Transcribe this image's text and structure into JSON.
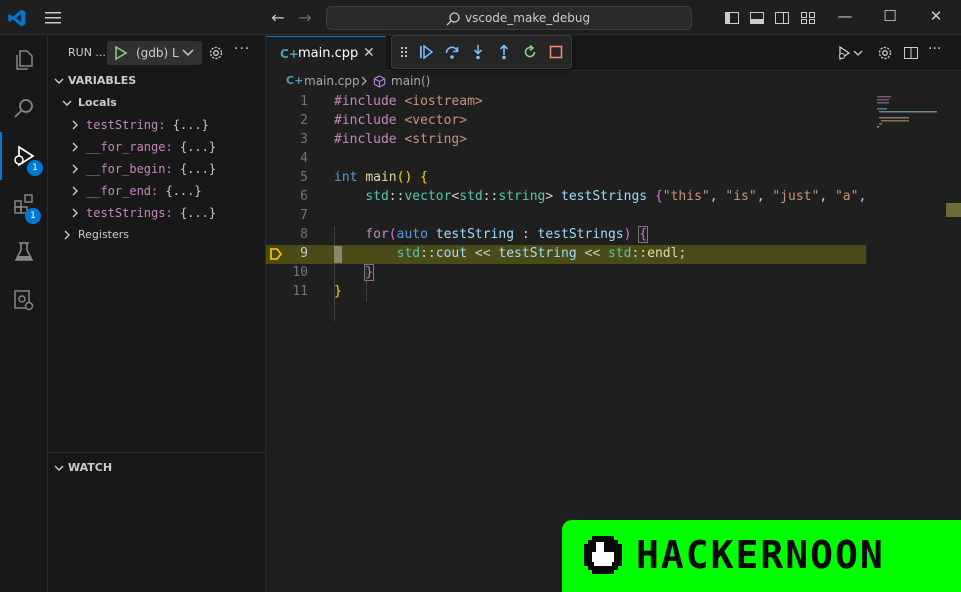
{
  "titlebar": {
    "search_text": "vscode_make_debug",
    "back_icon": "arrow-left-icon",
    "forward_icon": "arrow-right-icon"
  },
  "activity": {
    "debug_badge": "1",
    "extensions_badge": "1"
  },
  "sidebar": {
    "run_label": "RUN ...",
    "config_name": "(gdb) L",
    "more": "···",
    "variables_title": "VARIABLES",
    "locals_label": "Locals",
    "locals": [
      {
        "name": "testString:",
        "value": "{...}"
      },
      {
        "name": "__for_range:",
        "value": "{...}"
      },
      {
        "name": "__for_begin:",
        "value": "{...}"
      },
      {
        "name": "__for_end:",
        "value": "{...}"
      },
      {
        "name": "testStrings:",
        "value": "{...}"
      }
    ],
    "registers_label": "Registers",
    "watch_title": "WATCH"
  },
  "editor": {
    "tab_label": "main.cpp",
    "tab_icon": "C+",
    "close": "✕",
    "breadcrumb_file": "main.cpp",
    "breadcrumb_symbol": "main()",
    "current_line": 9,
    "line_numbers": [
      "1",
      "2",
      "3",
      "4",
      "5",
      "6",
      "7",
      "8",
      "9",
      "10",
      "11"
    ]
  },
  "watermark": {
    "text": "HACKERNOON"
  },
  "colors": {
    "accent": "#0078d4",
    "current_line_bg": "#4b4b18",
    "watermark_bg": "#00ff00"
  }
}
